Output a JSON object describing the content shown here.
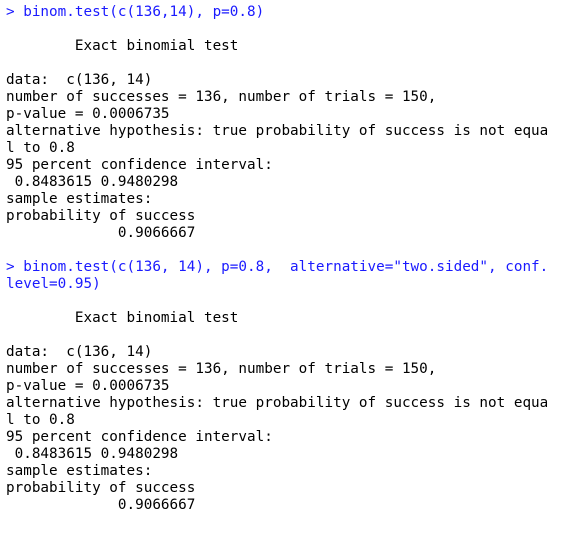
{
  "console": {
    "blocks": [
      {
        "command_lines": [
          "> binom.test(c(136,14), p=0.8)"
        ],
        "output_lines": [
          "",
          "        Exact binomial test",
          "",
          "data:  c(136, 14)",
          "number of successes = 136, number of trials = 150,",
          "p-value = 0.0006735",
          "alternative hypothesis: true probability of success is not equa",
          "l to 0.8",
          "95 percent confidence interval:",
          " 0.8483615 0.9480298",
          "sample estimates:",
          "probability of success",
          "             0.9066667",
          ""
        ]
      },
      {
        "command_lines": [
          "> binom.test(c(136, 14), p=0.8,  alternative=\"two.sided\", conf.",
          "level=0.95)"
        ],
        "output_lines": [
          "",
          "        Exact binomial test",
          "",
          "data:  c(136, 14)",
          "number of successes = 136, number of trials = 150,",
          "p-value = 0.0006735",
          "alternative hypothesis: true probability of success is not equa",
          "l to 0.8",
          "95 percent confidence interval:",
          " 0.8483615 0.9480298",
          "sample estimates:",
          "probability of success",
          "             0.9066667"
        ]
      }
    ]
  }
}
